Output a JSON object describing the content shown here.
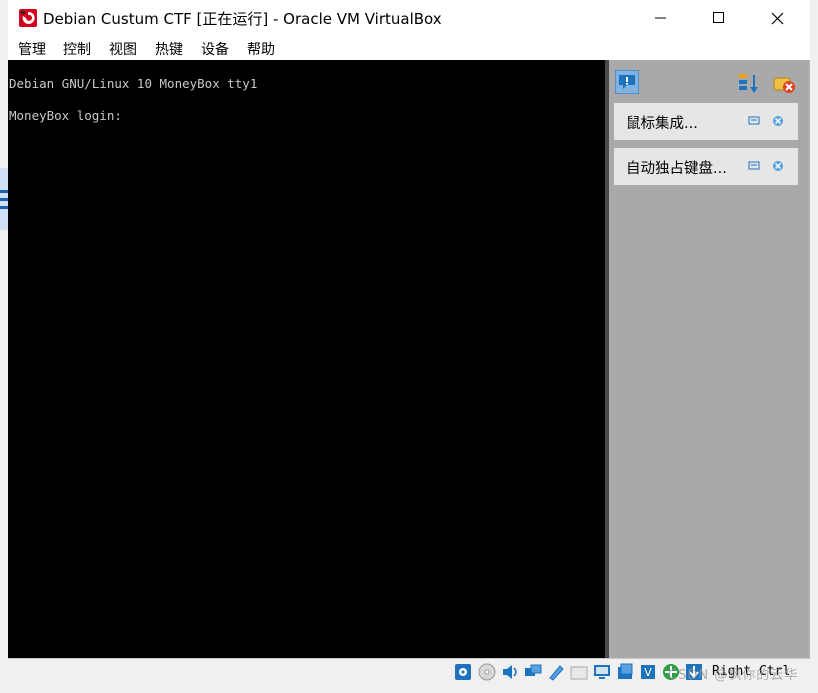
{
  "window": {
    "title": "Debian Custum CTF [正在运行] - Oracle VM VirtualBox"
  },
  "menu": {
    "items": [
      "管理",
      "控制",
      "视图",
      "热键",
      "设备",
      "帮助"
    ]
  },
  "console": {
    "lines": [
      "Debian GNU/Linux 10 MoneyBox tty1",
      "MoneyBox login:"
    ]
  },
  "notifications": {
    "items": [
      {
        "label": "鼠标集成..."
      },
      {
        "label": "自动独占键盘..."
      }
    ]
  },
  "statusbar": {
    "host_key": "Right Ctrl",
    "watermark": "CSDN @枫你的云华"
  },
  "colors": {
    "console_bg": "#000000",
    "console_text": "#c8c8c8",
    "panel_bg": "#a9a9a9",
    "accent_blue": "#1e73be",
    "app_icon_red": "#d5001c"
  },
  "icons": {
    "titlebar": [
      "virtualbox-logo-icon",
      "minimize-icon",
      "maximize-icon",
      "close-icon"
    ],
    "panel": [
      "notification-center-icon",
      "sort-icon",
      "delete-all-icon",
      "keep-icon",
      "dismiss-icon"
    ],
    "statusbar": [
      "hard-disk-icon",
      "optical-drive-icon",
      "audio-icon",
      "network-icon",
      "usb-icon",
      "shared-folders-icon",
      "display-icon",
      "recording-icon",
      "cpu-icon",
      "mouse-integration-icon",
      "keyboard-capture-icon"
    ]
  }
}
